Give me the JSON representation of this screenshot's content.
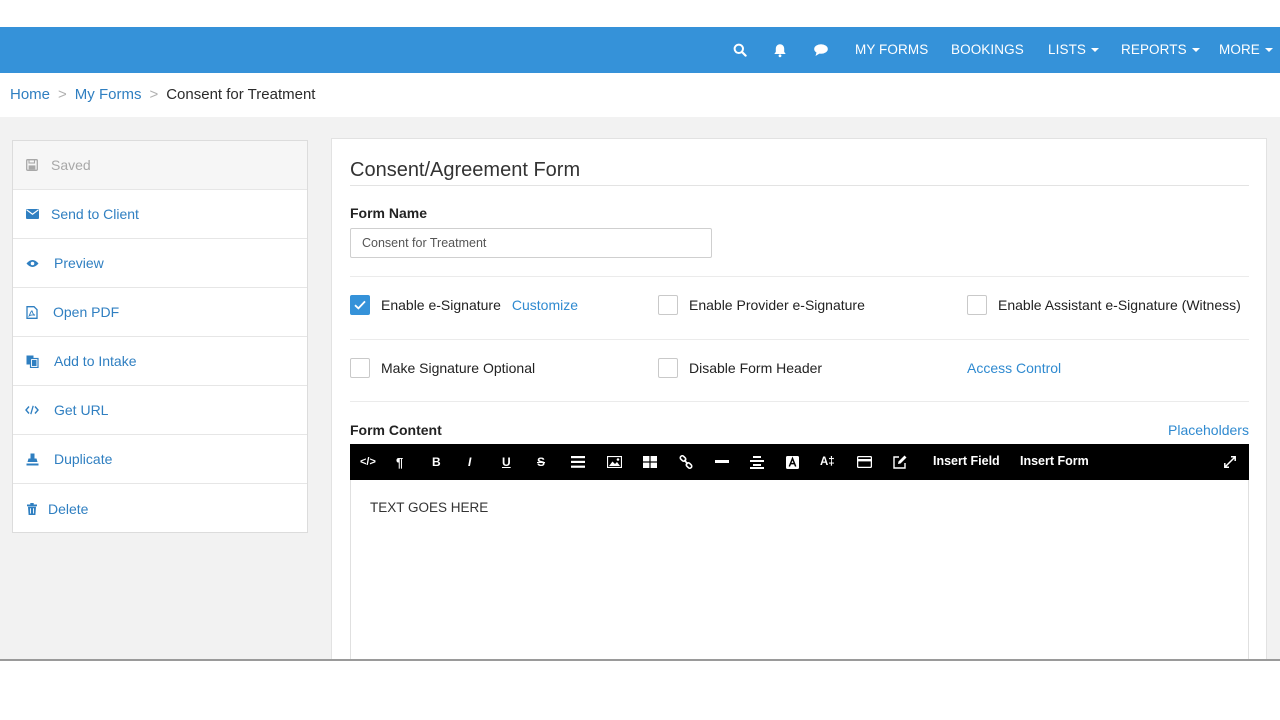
{
  "nav": {
    "links": [
      "MY FORMS",
      "BOOKINGS",
      "LISTS",
      "REPORTS",
      "MORE"
    ],
    "icons": [
      "search-icon",
      "bell-icon",
      "chat-icon"
    ]
  },
  "breadcrumb": {
    "home": "Home",
    "forms": "My Forms",
    "current": "Consent for Treatment",
    "separator": ">"
  },
  "sidebar": {
    "items": [
      {
        "label": "Saved",
        "icon": "floppy-icon"
      },
      {
        "label": "Send to Client",
        "icon": "envelope-icon"
      },
      {
        "label": "Preview",
        "icon": "eye-icon"
      },
      {
        "label": "Open PDF",
        "icon": "pdf-icon"
      },
      {
        "label": "Add to Intake",
        "icon": "copy-icon"
      },
      {
        "label": "Get URL",
        "icon": "code-icon"
      },
      {
        "label": "Duplicate",
        "icon": "stamp-icon"
      },
      {
        "label": "Delete",
        "icon": "trash-icon"
      }
    ]
  },
  "main": {
    "title": "Consent/Agreement Form",
    "form_name_label": "Form Name",
    "form_name_value": "Consent for Treatment",
    "options": {
      "enable_esig": {
        "label": "Enable e-Signature",
        "checked": true
      },
      "customize": "Customize",
      "provider_esig": {
        "label": "Enable Provider e-Signature",
        "checked": false
      },
      "assistant_esig": {
        "label": "Enable Assistant e-Signature (Witness)",
        "checked": false
      },
      "sig_optional": {
        "label": "Make Signature Optional",
        "checked": false
      },
      "disable_header": {
        "label": "Disable Form Header",
        "checked": false
      },
      "access_control": "Access Control"
    },
    "content_label": "Form Content",
    "placeholders": "Placeholders",
    "toolbar": {
      "insert_field": "Insert Field",
      "insert_form": "Insert Form",
      "bold": "B",
      "italic": "I",
      "underline": "U",
      "strike": "S",
      "pilcrow": "¶",
      "code": "</>",
      "font_size": "A‡"
    },
    "editor_text": "TEXT GOES HERE"
  },
  "colors": {
    "accent": "#3592d9",
    "link": "#2f7fc1",
    "toolbar_bg": "#000000"
  }
}
